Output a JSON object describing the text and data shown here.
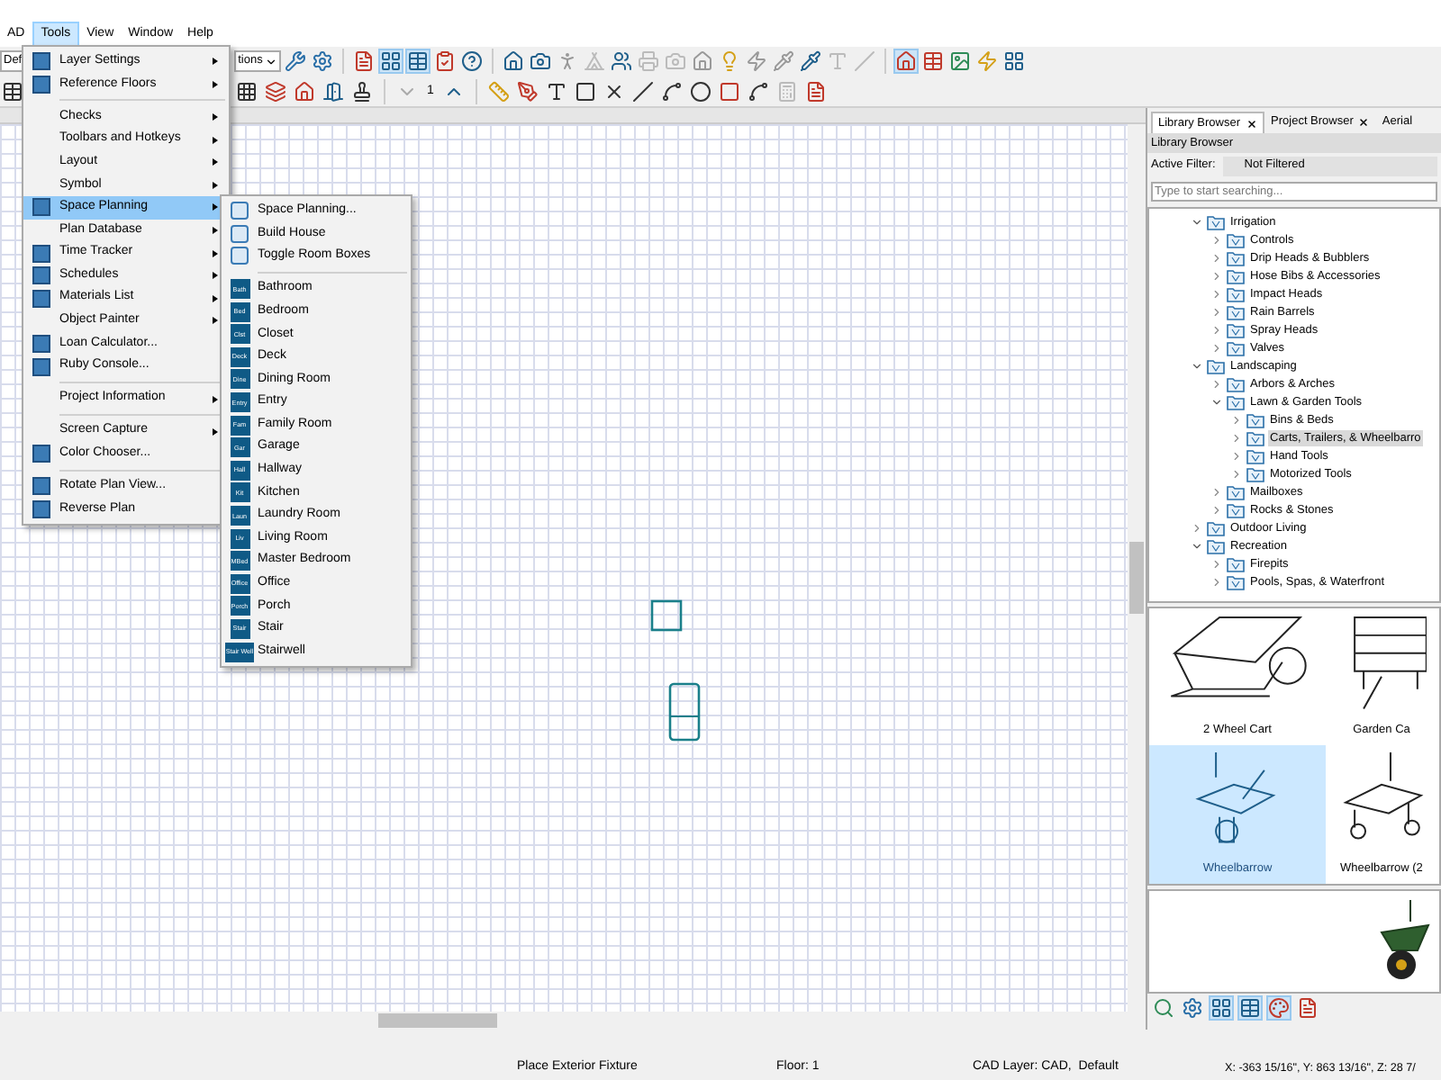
{
  "menu_bar": [
    {
      "label": "AD",
      "selected": false
    },
    {
      "label": "Tools",
      "selected": true
    },
    {
      "label": "View",
      "selected": false
    },
    {
      "label": "Window",
      "selected": false
    },
    {
      "label": "Help",
      "selected": false
    }
  ],
  "toolbar": {
    "preset_field": "Def",
    "dropdown": "tions",
    "floor_value": "1"
  },
  "tools_menu": {
    "items": [
      {
        "kind": "icon_item",
        "label": "Layer Settings",
        "submenu": true,
        "selected": false
      },
      {
        "kind": "icon_item",
        "label": "Reference Floors",
        "submenu": true,
        "selected": false
      },
      {
        "kind": "separator"
      },
      {
        "kind": "item",
        "label": "Checks",
        "submenu": true,
        "selected": false
      },
      {
        "kind": "item",
        "label": "Toolbars and Hotkeys",
        "submenu": true,
        "selected": false
      },
      {
        "kind": "item",
        "label": "Layout",
        "submenu": true,
        "selected": false
      },
      {
        "kind": "item",
        "label": "Symbol",
        "submenu": true,
        "selected": false
      },
      {
        "kind": "icon_item",
        "label": "Space Planning",
        "submenu": true,
        "selected": true
      },
      {
        "kind": "item",
        "label": "Plan Database",
        "submenu": true,
        "selected": false
      },
      {
        "kind": "icon_item",
        "label": "Time Tracker",
        "submenu": true,
        "selected": false
      },
      {
        "kind": "icon_item",
        "label": "Schedules",
        "submenu": true,
        "selected": false
      },
      {
        "kind": "icon_item",
        "label": "Materials List",
        "submenu": true,
        "selected": false
      },
      {
        "kind": "item",
        "label": "Object Painter",
        "submenu": true,
        "selected": false
      },
      {
        "kind": "icon_item",
        "label": "Loan Calculator...",
        "submenu": false,
        "selected": false
      },
      {
        "kind": "icon_item",
        "label": "Ruby Console...",
        "submenu": false,
        "selected": false
      },
      {
        "kind": "separator"
      },
      {
        "kind": "item",
        "label": "Project Information",
        "submenu": true,
        "selected": false
      },
      {
        "kind": "separator"
      },
      {
        "kind": "item",
        "label": "Screen Capture",
        "submenu": true,
        "selected": false
      },
      {
        "kind": "icon_item",
        "label": "Color Chooser...",
        "submenu": false,
        "selected": false
      },
      {
        "kind": "separator"
      },
      {
        "kind": "icon_item",
        "label": "Rotate Plan View...",
        "submenu": false,
        "selected": false
      },
      {
        "kind": "icon_item",
        "label": "Reverse Plan",
        "submenu": false,
        "selected": false
      }
    ]
  },
  "space_planning_menu": {
    "items": [
      {
        "kind": "command",
        "label": "Space Planning..."
      },
      {
        "kind": "command",
        "label": "Build House"
      },
      {
        "kind": "command",
        "label": "Toggle Room Boxes"
      },
      {
        "kind": "separator"
      },
      {
        "kind": "room",
        "badge": "Bath",
        "label": "Bathroom"
      },
      {
        "kind": "room",
        "badge": "Bed",
        "label": "Bedroom"
      },
      {
        "kind": "room",
        "badge": "Clst",
        "label": "Closet"
      },
      {
        "kind": "room",
        "badge": "Deck",
        "label": "Deck"
      },
      {
        "kind": "room",
        "badge": "Dine",
        "label": "Dining Room"
      },
      {
        "kind": "room",
        "badge": "Entry",
        "label": "Entry"
      },
      {
        "kind": "room",
        "badge": "Fam",
        "label": "Family Room"
      },
      {
        "kind": "room",
        "badge": "Gar",
        "label": "Garage"
      },
      {
        "kind": "room",
        "badge": "Hall",
        "label": "Hallway"
      },
      {
        "kind": "room",
        "badge": "Kit",
        "label": "Kitchen"
      },
      {
        "kind": "room",
        "badge": "Laun",
        "label": "Laundry Room"
      },
      {
        "kind": "room",
        "badge": "Liv",
        "label": "Living Room"
      },
      {
        "kind": "room",
        "badge": "MBed",
        "label": "Master Bedroom"
      },
      {
        "kind": "room",
        "badge": "Office",
        "label": "Office"
      },
      {
        "kind": "room",
        "badge": "Porch",
        "label": "Porch"
      },
      {
        "kind": "room",
        "badge": "Stair",
        "label": "Stair"
      },
      {
        "kind": "room",
        "badge": "Stair Well",
        "label": "Stairwell"
      }
    ]
  },
  "library_panel": {
    "tabs": [
      {
        "label": "Library Browser",
        "closable": true,
        "selected": true
      },
      {
        "label": "Project Browser",
        "closable": true,
        "selected": false
      },
      {
        "label": "Aerial",
        "closable": false,
        "selected": false
      }
    ],
    "title": "Library Browser",
    "filter_label": "Active Filter:",
    "filter_value": "Not Filtered",
    "search": {
      "placeholder": "Type to start searching..."
    },
    "tree": [
      {
        "label": "Irrigation",
        "expanded": true,
        "selected": false,
        "children": [
          {
            "label": "Controls",
            "expanded": false,
            "selected": false
          },
          {
            "label": "Drip Heads & Bubblers",
            "expanded": false,
            "selected": false
          },
          {
            "label": "Hose Bibs & Accessories",
            "expanded": false,
            "selected": false
          },
          {
            "label": "Impact Heads",
            "expanded": false,
            "selected": false
          },
          {
            "label": "Rain Barrels",
            "expanded": false,
            "selected": false
          },
          {
            "label": "Spray Heads",
            "expanded": false,
            "selected": false
          },
          {
            "label": "Valves",
            "expanded": false,
            "selected": false
          }
        ]
      },
      {
        "label": "Landscaping",
        "expanded": true,
        "selected": false,
        "children": [
          {
            "label": "Arbors & Arches",
            "expanded": false,
            "selected": false
          },
          {
            "label": "Lawn & Garden Tools",
            "expanded": true,
            "selected": false,
            "children": [
              {
                "label": "Bins & Beds",
                "expanded": false,
                "selected": false
              },
              {
                "label": "Carts, Trailers, & Wheelbarro",
                "expanded": false,
                "selected": true
              },
              {
                "label": "Hand Tools",
                "expanded": false,
                "selected": false
              },
              {
                "label": "Motorized Tools",
                "expanded": false,
                "selected": false
              }
            ]
          },
          {
            "label": "Mailboxes",
            "expanded": false,
            "selected": false
          },
          {
            "label": "Rocks & Stones",
            "expanded": false,
            "selected": false
          }
        ]
      },
      {
        "label": "Outdoor Living",
        "expanded": false,
        "selected": false
      },
      {
        "label": "Recreation",
        "expanded": true,
        "selected": false,
        "children": [
          {
            "label": "Firepits",
            "expanded": false,
            "selected": false
          },
          {
            "label": "Pools, Spas, & Waterfront",
            "expanded": false,
            "selected": false
          }
        ]
      }
    ],
    "items": [
      {
        "kind": "cart",
        "label": "2 Wheel Cart",
        "selected": false
      },
      {
        "kind": "wagon",
        "label": "Garden Ca",
        "selected": false
      },
      {
        "kind": "wheelbarrow",
        "label": "Wheelbarrow",
        "selected": true
      },
      {
        "kind": "wheelbarrow2",
        "label": "Wheelbarrow (2",
        "selected": false
      }
    ]
  },
  "status_bar": {
    "message": "Place Exterior Fixture",
    "floor": "Floor: 1",
    "layer": "CAD Layer: CAD,  Default",
    "coordinates": "X: -363 15/16\", Y: 863 13/16\", Z: 28 7/"
  }
}
